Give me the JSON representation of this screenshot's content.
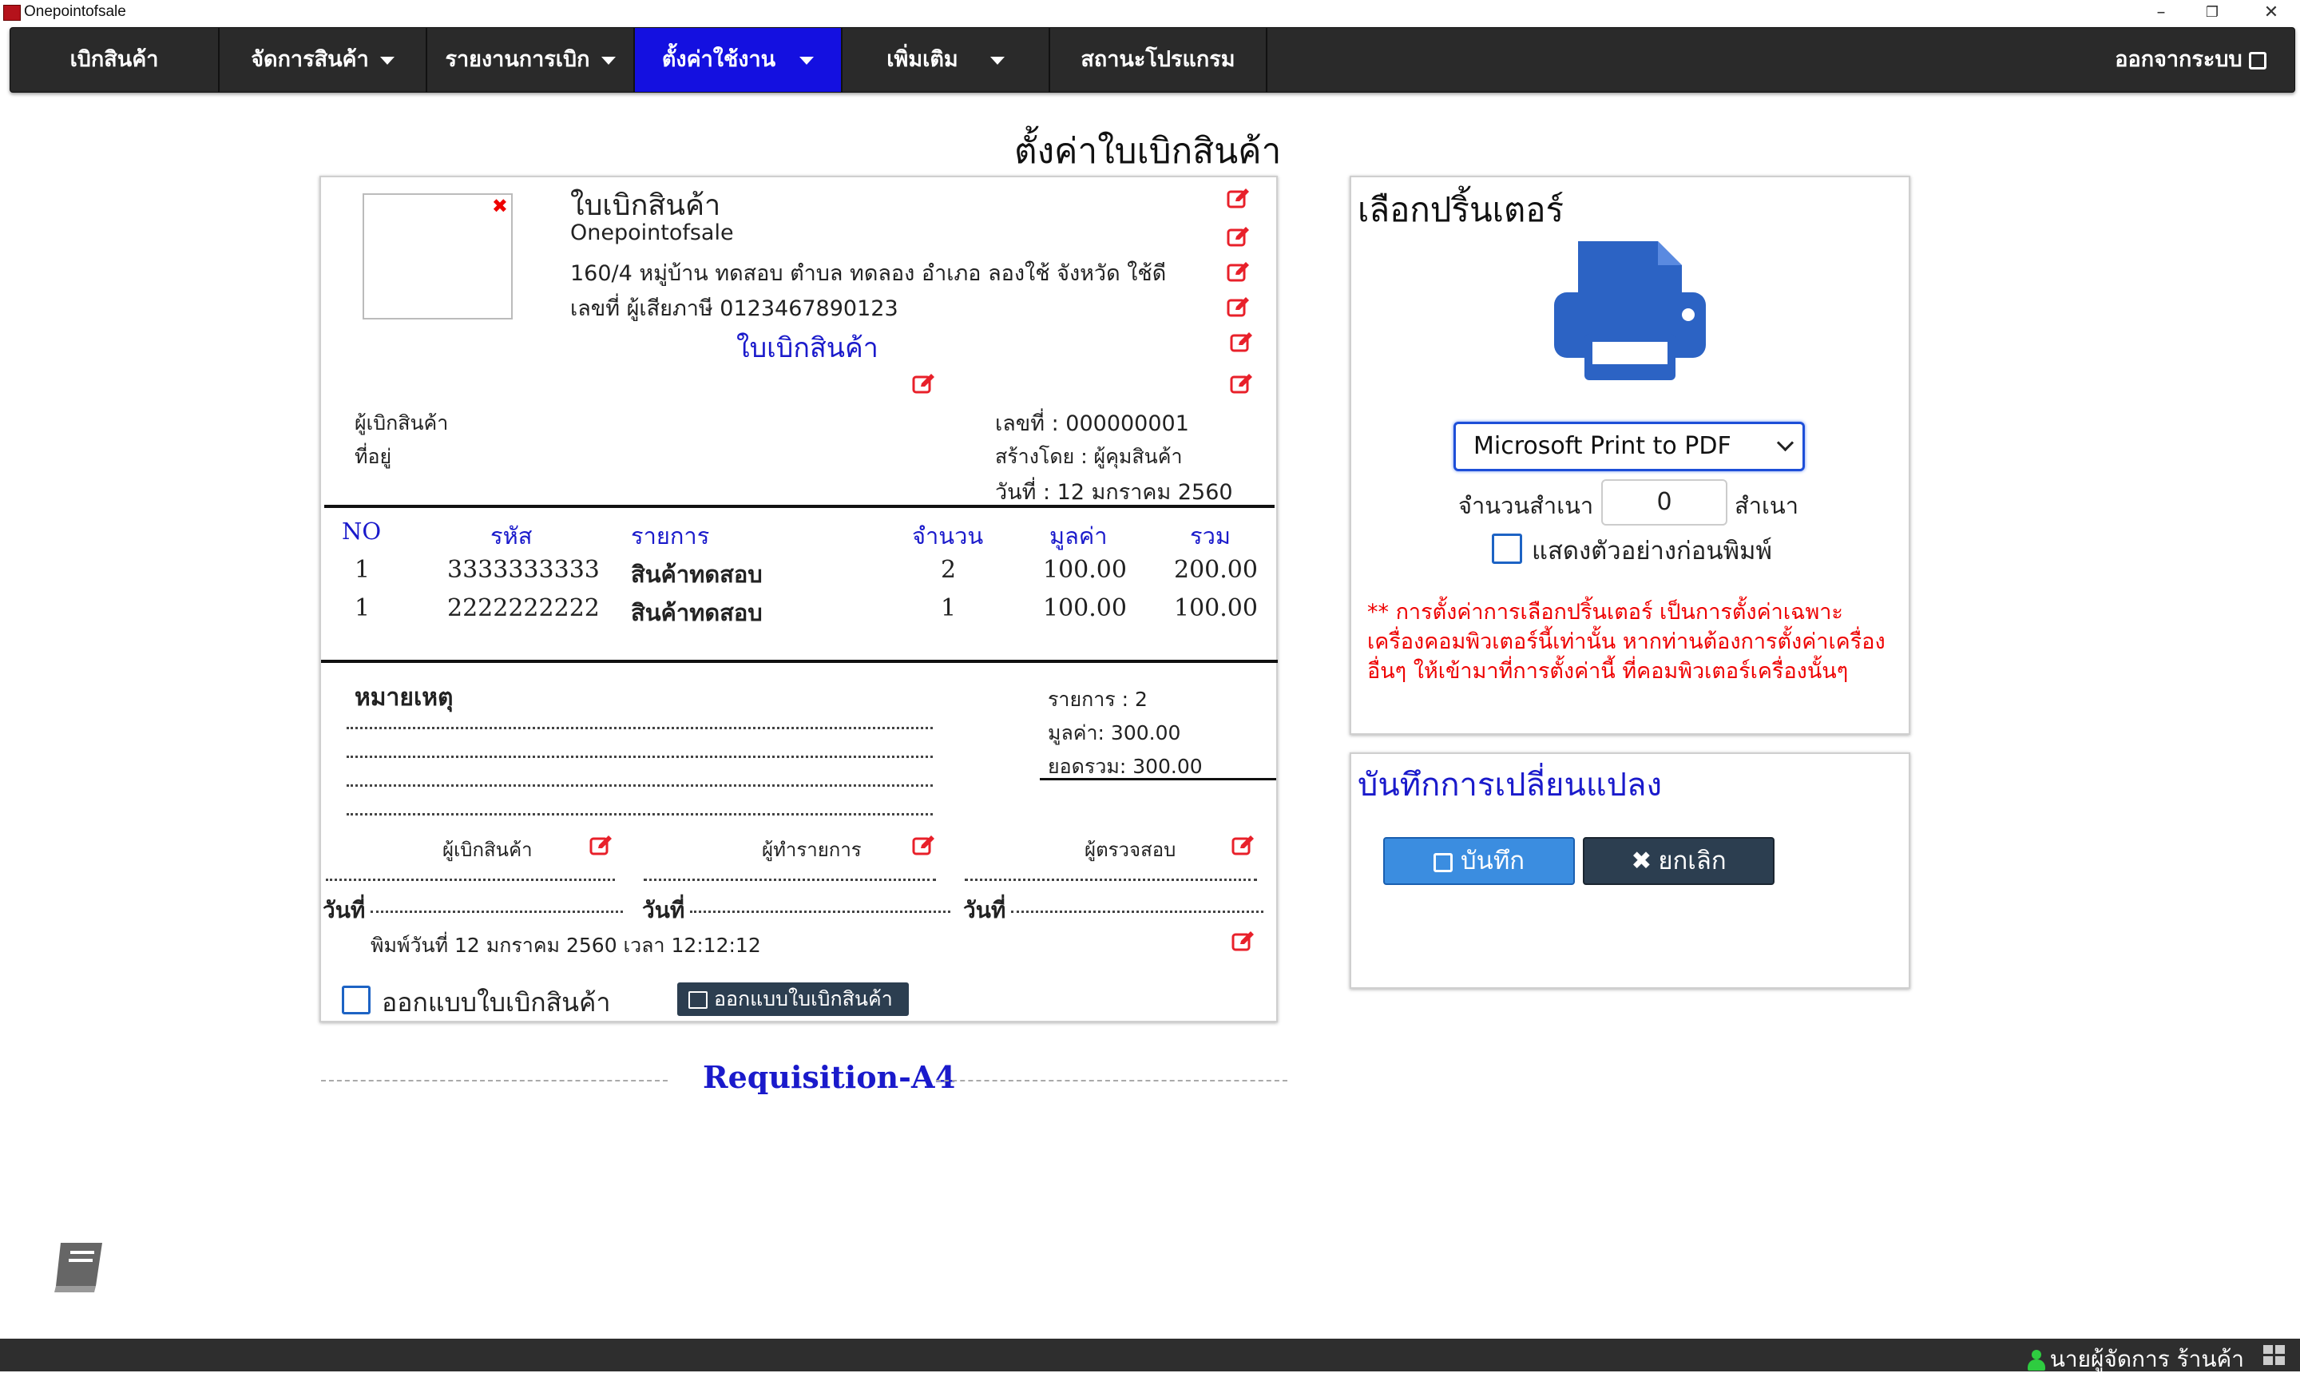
{
  "window": {
    "title": "Onepointofsale",
    "minimize": "–",
    "restore": "❐",
    "close": "✕"
  },
  "nav": {
    "items": [
      {
        "label": "เบิกสินค้า"
      },
      {
        "label": "จัดการสินค้า"
      },
      {
        "label": "รายงานการเบิก"
      },
      {
        "label": "ตั้งค่าใช้งาน"
      },
      {
        "label": "เพิ่มเติม"
      },
      {
        "label": "สถานะโปรแกรม"
      }
    ],
    "logout": "ออกจากระบบ"
  },
  "page_title": "ตั้งค่าใบเบิกสินค้า",
  "form": {
    "doc_title": "ใบเบิกสินค้า",
    "company": "Onepointofsale",
    "address": "160/4 หมู่บ้าน ทดสอบ ตำบล ทดลอง  อำเภอ ลองใช้ จังหวัด ใช้ดี",
    "tax_id": "เลขที่ ผู้เสียภาษี 0123467890123",
    "doc_heading": "ใบเบิกสินค้า",
    "requester_label": "ผู้เบิกสินค้า",
    "address_label": "ที่อยู่",
    "doc_no": "เลขที่ : 000000001",
    "created_by": "สร้างโดย : ผู้คุมสินค้า",
    "date": "วันที่ : 12 มกราคม 2560",
    "table": {
      "headers": [
        "NO",
        "รหัส",
        "รายการ",
        "จำนวน",
        "มูลค่า",
        "รวม"
      ],
      "rows": [
        [
          "1",
          "3333333333",
          "สินค้าทดสอบ",
          "2",
          "100.00",
          "200.00"
        ],
        [
          "1",
          "2222222222",
          "สินค้าทดสอบ",
          "1",
          "100.00",
          "100.00"
        ]
      ]
    },
    "remark_label": "หมายเหตุ",
    "summary_items": "รายการ : 2",
    "summary_value": "มูลค่า: 300.00",
    "summary_total": "ยอดรวม: 300.00",
    "sign_requester": "ผู้เบิกสินค้า",
    "sign_maker": "ผู้ทำรายการ",
    "sign_checker": "ผู้ตรวจสอบ",
    "date_prefix": "วันที่",
    "print_line": "พิมพ์วันที่ 12 มกราคม 2560 เวลา 12:12:12",
    "design_checkbox_label": "ออกแบบใบเบิกสินค้า",
    "design_button": "ออกแบบใบเบิกสินค้า",
    "template_name": "Requisition-A4"
  },
  "printer": {
    "title": "เลือกปริ้นเตอร์",
    "selected": "Microsoft Print to PDF",
    "copies_label": "จำนวนสำเนา",
    "copies_value": "0",
    "copies_unit": "สำเนา",
    "preview_label": "แสดงตัวอย่างก่อนพิมพ์",
    "note": "** การตั้งค่าการเลือกปริ้นเตอร์ เป็นการตั้งค่าเฉพาะเครื่องคอมพิวเตอร์นี้เท่านั้น หากท่านต้องการตั้งค่าเครื่องอื่นๆ ให้เข้ามาที่การตั้งค่านี้ ที่คอมพิวเตอร์เครื่องนั้นๆ",
    "icon": "printer-icon"
  },
  "changes": {
    "title": "บันทึกการเปลี่ยนแปลง",
    "save": "บันทึก",
    "cancel": "ยกเลิก"
  },
  "status": {
    "user": "นายผู้จัดการ ร้านค้า"
  },
  "colors": {
    "accent": "#1410e0",
    "edit": "#e8202a",
    "blue_text": "#1a1acb",
    "save": "#3b8de0",
    "dark": "#2c3e50"
  }
}
